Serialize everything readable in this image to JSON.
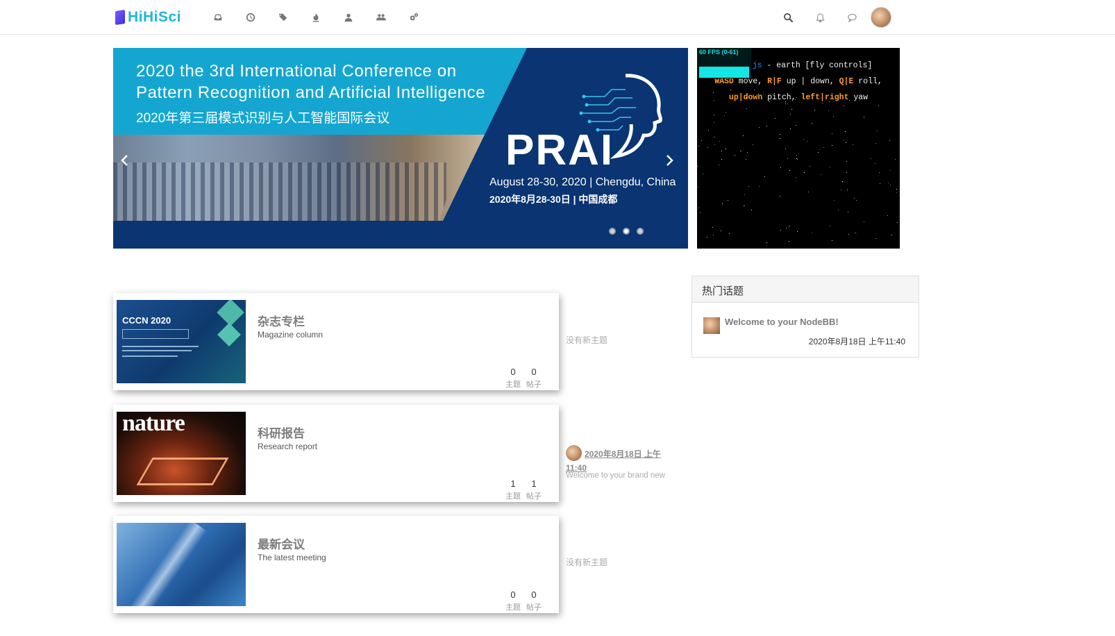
{
  "header": {
    "logo_text": "HiHiSci",
    "nav_icons": [
      "inbox-icon",
      "clock-icon",
      "tags-icon",
      "fire-icon",
      "user-icon",
      "users-icon",
      "gears-icon"
    ],
    "right_icons": [
      "search-icon",
      "bell-icon",
      "chat-icon"
    ]
  },
  "carousel": {
    "title_en_1": "2020 the 3rd International Conference on",
    "title_en_2": "Pattern Recognition and Artificial Intelligence",
    "title_cn": "2020年第三届模式识别与人工智能国际会议",
    "acronym": "PRAI",
    "date_en": "August 28-30, 2020 | Chengdu, China",
    "date_cn": "2020年8月28-30日 | 中国成都",
    "slide_count": 3,
    "active_slide": 1
  },
  "earth_panel": {
    "fps": "60 FPS (0-61)",
    "link": "js",
    "line1_rest": " - earth [fly controls]",
    "line2_k1": "WASD",
    "line2_t1": " move, ",
    "line2_k2": "R|F",
    "line2_t2": " up | down, ",
    "line2_k3": "Q|E",
    "line2_t3": " roll,",
    "line3_k1": "up|down",
    "line3_t1": " pitch, ",
    "line3_k2": "left|right",
    "line3_t2": " yaw"
  },
  "categories": [
    {
      "title": "杂志专栏",
      "subtitle": "Magazine column",
      "topics": "0",
      "posts": "0",
      "topics_label": "主题",
      "posts_label": "帖子",
      "image_caption": "CCCN 2020",
      "last": "没有新主题"
    },
    {
      "title": "科研报告",
      "subtitle": "Research report",
      "topics": "1",
      "posts": "1",
      "topics_label": "主题",
      "posts_label": "帖子",
      "image_caption": "nature",
      "last_time": "2020年8月18日 上午11:40",
      "last_snippet": "Welcome to your brand new"
    },
    {
      "title": "最新会议",
      "subtitle": "The latest meeting",
      "topics": "0",
      "posts": "0",
      "topics_label": "主题",
      "posts_label": "帖子",
      "last": "没有新主题"
    }
  ],
  "hot_topics": {
    "heading": "热门话题",
    "items": [
      {
        "title": "Welcome to your NodeBB!",
        "time": "2020年8月18日 上午11:40"
      }
    ]
  }
}
